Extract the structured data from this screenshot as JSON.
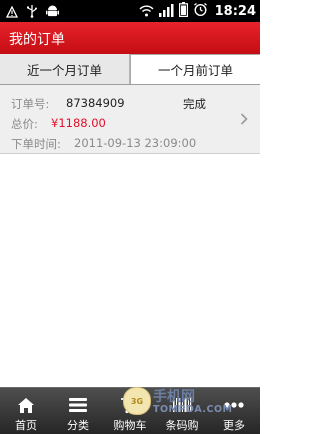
{
  "status_bar": {
    "time": "18:24",
    "icons": [
      "warning-icon",
      "usb-icon",
      "android-icon",
      "wifi-icon",
      "signal-icon",
      "battery-icon",
      "alarm-icon"
    ]
  },
  "header": {
    "title": "我的订单"
  },
  "tabs": [
    {
      "label": "近一个月订单",
      "selected": true
    },
    {
      "label": "一个月前订单",
      "selected": false
    }
  ],
  "order": {
    "number_label": "订单号:",
    "number": "87384909",
    "status": "完成",
    "total_label": "总价:",
    "total": "¥1188.00",
    "time_label": "下单时间:",
    "time": "2011-09-13 23:09:00"
  },
  "bottom_nav": [
    {
      "label": "首页",
      "icon": "home-icon"
    },
    {
      "label": "分类",
      "icon": "list-icon"
    },
    {
      "label": "购物车",
      "icon": "cart-icon"
    },
    {
      "label": "条码购",
      "icon": "barcode-icon"
    },
    {
      "label": "更多",
      "icon": "more-icon"
    }
  ],
  "watermark": {
    "line1": "手机网",
    "line2": "TOMPDA.COM",
    "logo_text": "3G"
  },
  "colors": {
    "accent": "#d7141c",
    "price": "#e0102a"
  }
}
